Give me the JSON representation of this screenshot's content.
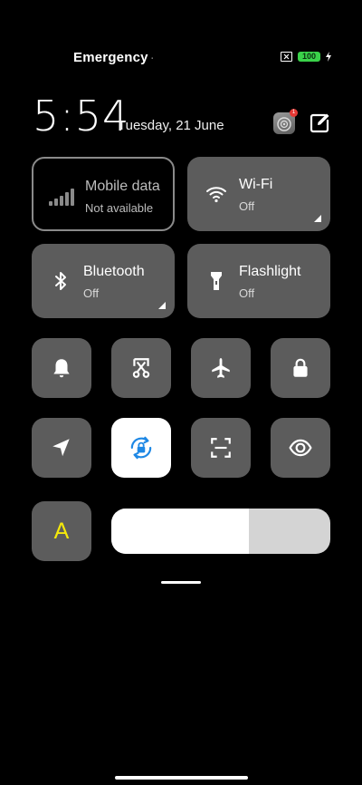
{
  "status_bar": {
    "carrier": "Emergency",
    "battery_level": "100"
  },
  "header": {
    "time": "5:54",
    "date": "Tuesday, 21 June",
    "notification_badge": "1"
  },
  "tiles": {
    "mobile_data": {
      "label": "Mobile data",
      "status": "Not available"
    },
    "wifi": {
      "label": "Wi-Fi",
      "status": "Off"
    },
    "bluetooth": {
      "label": "Bluetooth",
      "status": "Off"
    },
    "flashlight": {
      "label": "Flashlight",
      "status": "Off"
    }
  },
  "auto_brightness": {
    "label": "A"
  },
  "brightness": {
    "level": 0.63
  },
  "colors": {
    "tile": "#5c5c5c",
    "accent": "#1e88e5",
    "auto_brightness": "#f5e90b",
    "battery": "#3ad34a"
  },
  "icons": [
    "sim-card-icon",
    "battery-icon",
    "charging-bolt-icon",
    "app-icon",
    "edit-icon",
    "signal-bars-icon",
    "wifi-icon",
    "bluetooth-icon",
    "flashlight-icon",
    "bell-icon",
    "screenshot-icon",
    "airplane-icon",
    "lock-icon",
    "location-icon",
    "rotation-lock-icon",
    "scan-icon",
    "eye-icon"
  ]
}
